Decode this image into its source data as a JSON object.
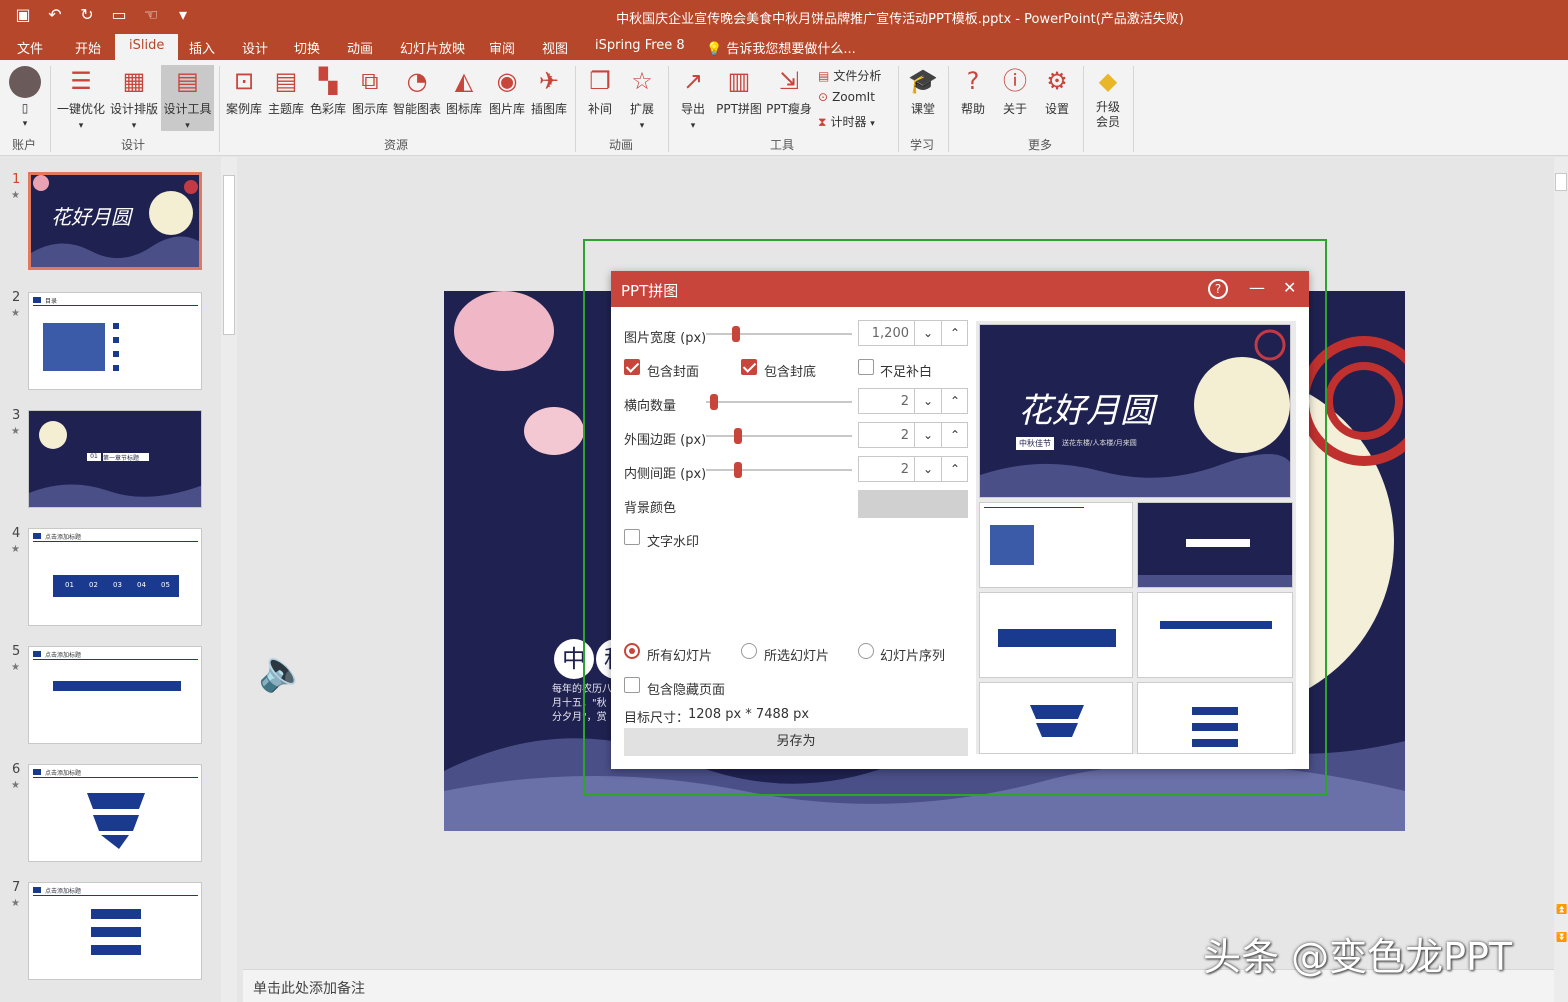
{
  "window": {
    "title": "中秋国庆企业宣传晚会美食中秋月饼品牌推广宣传活动PPT模板.pptx - PowerPoint(产品激活失败)"
  },
  "menu": {
    "tabs": [
      "文件",
      "开始",
      "iSlide",
      "插入",
      "设计",
      "切换",
      "动画",
      "幻灯片放映",
      "审阅",
      "视图",
      "iSpring Free 8"
    ],
    "active": "iSlide",
    "tellme": "告诉我您想要做什么..."
  },
  "ribbon": {
    "account": {
      "label": "账户",
      "avatar_caption": "▯"
    },
    "design": {
      "group": "设计",
      "buttons": [
        "一键优化",
        "设计排版",
        "设计工具"
      ]
    },
    "resources": {
      "group": "资源",
      "buttons": [
        "案例库",
        "主题库",
        "色彩库",
        "图示库",
        "智能图表",
        "图标库",
        "图片库",
        "插图库"
      ]
    },
    "animation": {
      "group": "动画",
      "buttons": [
        "补间",
        "扩展"
      ]
    },
    "tools": {
      "group": "工具",
      "buttons": [
        "导出",
        "PPT拼图",
        "PPT瘦身"
      ],
      "small": [
        "文件分析",
        "ZoomIt",
        "计时器"
      ]
    },
    "learn": {
      "group": "学习",
      "buttons": [
        "课堂"
      ]
    },
    "more": {
      "group": "更多",
      "buttons": [
        "帮助",
        "关于",
        "设置"
      ]
    },
    "upgrade": {
      "label": "升级会员"
    }
  },
  "slides": {
    "numbers": [
      "1",
      "2",
      "3",
      "4",
      "5",
      "6",
      "7"
    ],
    "selected": 1
  },
  "thumbs": {
    "t1_title": "花好月圆",
    "t2_title": "目录",
    "t3_badge": "01",
    "t3_text": "第一章节标题",
    "arrow_nums": [
      "01",
      "02",
      "03",
      "04",
      "05"
    ],
    "t4_header": "点击添加标题"
  },
  "main_slide": {
    "chars": [
      "中",
      "秋"
    ],
    "body": "每年的农历八月十五，\"秋分夕月\"，赏月和庆祝活动。"
  },
  "dialog": {
    "title": "PPT拼图",
    "width_label": "图片宽度 (px)",
    "width_value": "1,200",
    "cover_label": "包含封面",
    "back_label": "包含封底",
    "pad_label": "不足补白",
    "cols_label": "横向数量",
    "cols_value": "2",
    "outer_label": "外围边距 (px)",
    "outer_value": "2",
    "inner_label": "内侧间距 (px)",
    "inner_value": "2",
    "bg_label": "背景颜色",
    "watermark_label": "文字水印",
    "scope": [
      "所有幻灯片",
      "所选幻灯片",
      "幻灯片序列"
    ],
    "hidden_label": "包含隐藏页面",
    "target_label": "目标尺寸：",
    "target_value": "1208 px *  7488 px",
    "save_label": "另存为",
    "preview_title": "花好月圆",
    "preview_badge": "中秋佳节",
    "preview_sub": "送花东楼/人本楼/月来圆"
  },
  "notes": {
    "placeholder": "单击此处添加备注"
  },
  "watermark": "头条 @变色龙PPT",
  "colors": {
    "accent": "#b7472a",
    "dialog": "#c8453b",
    "slide_bg": "#1f2150",
    "green": "#2ea32e"
  }
}
